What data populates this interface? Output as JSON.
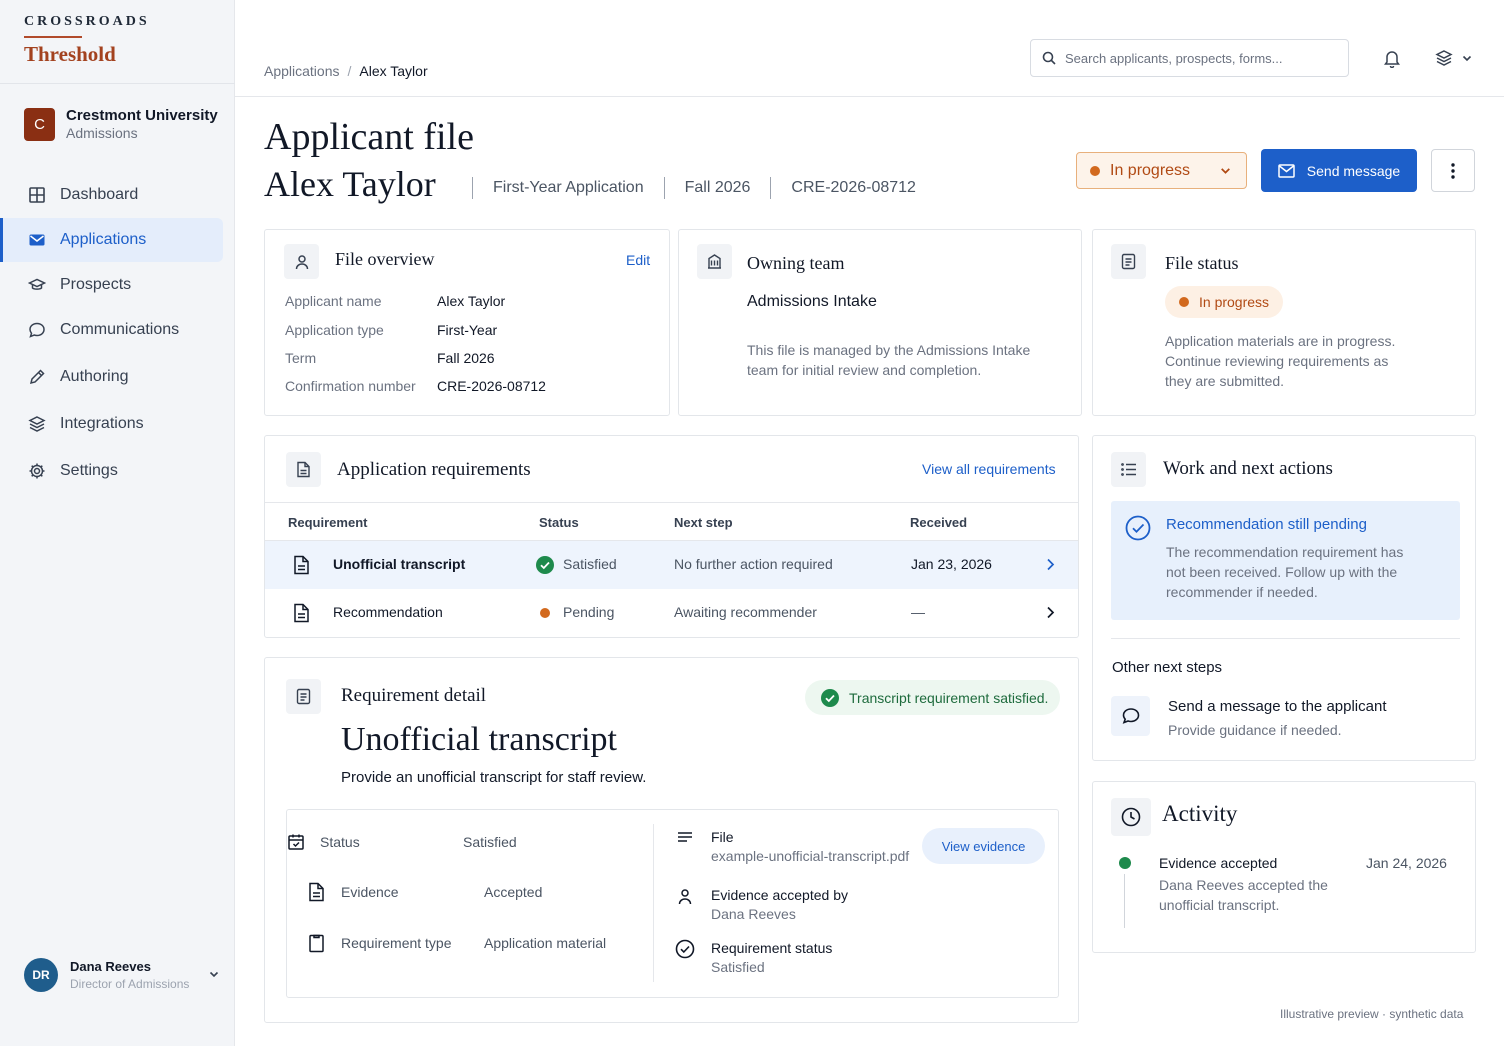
{
  "brand": {
    "top": "CROSSROADS",
    "name": "Threshold"
  },
  "org": {
    "initial": "C",
    "name": "Crestmont University",
    "sub": "Admissions"
  },
  "nav": {
    "items": [
      {
        "label": "Dashboard",
        "icon": "grid-icon"
      },
      {
        "label": "Applications",
        "icon": "mail-icon",
        "active": true
      },
      {
        "label": "Prospects",
        "icon": "graduation-cap-icon"
      },
      {
        "label": "Communications",
        "icon": "chat-icon"
      },
      {
        "label": "Authoring",
        "icon": "pencil-icon"
      },
      {
        "label": "Integrations",
        "icon": "layers-icon"
      },
      {
        "label": "Settings",
        "icon": "gear-icon"
      }
    ]
  },
  "user": {
    "initials": "DR",
    "name": "Dana Reeves",
    "role": "Director of Admissions"
  },
  "breadcrumb": {
    "parent": "Applications",
    "sep": "/",
    "current": "Alex Taylor"
  },
  "search": {
    "placeholder": "Search applicants, prospects, forms..."
  },
  "header": {
    "title": "Applicant file",
    "name": "Alex Taylor",
    "meta": [
      "First-Year Application",
      "Fall 2026",
      "CRE-2026-08712"
    ],
    "status": "In progress",
    "send_label": "Send message"
  },
  "file_overview": {
    "title": "File overview",
    "edit_label": "Edit",
    "fields": [
      {
        "k": "Applicant name",
        "v": "Alex Taylor"
      },
      {
        "k": "Application type",
        "v": "First-Year"
      },
      {
        "k": "Term",
        "v": "Fall 2026"
      },
      {
        "k": "Confirmation number",
        "v": "CRE-2026-08712"
      }
    ]
  },
  "owning_team": {
    "title": "Owning team",
    "team": "Admissions Intake",
    "desc": "This file is managed by the Admissions Intake team for initial review and completion."
  },
  "file_status": {
    "title": "File status",
    "status": "In progress",
    "desc": "Application materials are in progress. Continue reviewing requirements as they are submitted."
  },
  "requirements": {
    "title": "Application requirements",
    "view_all": "View all requirements",
    "columns": [
      "Requirement",
      "Status",
      "Next step",
      "Received"
    ],
    "rows": [
      {
        "name": "Unofficial transcript",
        "status": "Satisfied",
        "next": "No further action required",
        "received": "Jan 23, 2026"
      },
      {
        "name": "Recommendation",
        "status": "Pending",
        "next": "Awaiting recommender",
        "received": "—"
      }
    ]
  },
  "detail": {
    "section": "Requirement detail",
    "toast": "Transcript requirement satisfied.",
    "title": "Unofficial transcript",
    "subtitle": "Provide an unofficial transcript for staff review.",
    "rows": [
      {
        "k": "Status",
        "v": "Satisfied"
      },
      {
        "k": "Evidence",
        "v": "Accepted"
      },
      {
        "k": "Requirement type",
        "v": "Application material"
      }
    ],
    "file_label": "File",
    "file_name": "example-unofficial-transcript.pdf",
    "view_evidence": "View evidence",
    "accepted_by_label": "Evidence accepted by",
    "accepted_by": "Dana Reeves",
    "req_status_label": "Requirement status",
    "req_status": "Satisfied"
  },
  "work": {
    "title": "Work and next actions",
    "alert_title": "Recommendation still pending",
    "alert_desc": "The recommendation requirement has not been received. Follow up with the recommender if needed.",
    "other_label": "Other next steps",
    "step_title": "Send a message to the applicant",
    "step_desc": "Provide guidance if needed."
  },
  "activity": {
    "title": "Activity",
    "event": "Evidence accepted",
    "date": "Jan 24, 2026",
    "desc": "Dana Reeves accepted the unofficial transcript."
  },
  "footer": "Illustrative preview · synthetic data",
  "colors": {
    "accent": "#1d5fc9",
    "brand": "#a3421f",
    "success": "#1e8a4c",
    "warning": "#d2691e"
  }
}
